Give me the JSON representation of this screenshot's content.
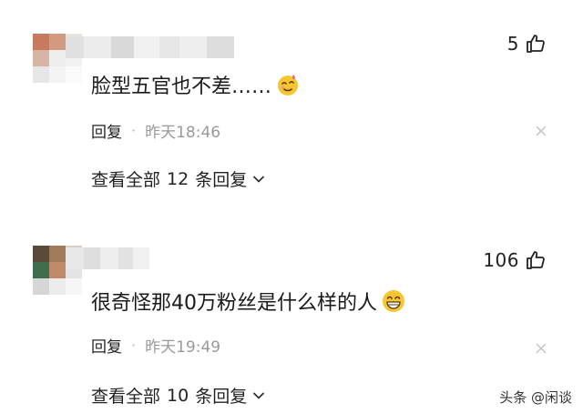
{
  "comments": [
    {
      "avatar_colors": [
        "#c77a5e",
        "#d49a80",
        "#e8e4e0",
        "#d8b4a4",
        "#eeeeee",
        "#f2f2f2",
        "#e6e6e6",
        "#f4f4f4",
        "#fafafa"
      ],
      "name_blur_colors": [
        "#e0e0e0",
        "#ececec",
        "#d9d9d9",
        "#f0f0f0",
        "#e6e6e6",
        "#eeeeee",
        "#dddddd"
      ],
      "likes": "5",
      "text": "脸型五官也不差……",
      "emoji": "smiling-face-with-tear-emoji",
      "reply_label": "回复",
      "separator": "·",
      "time": "昨天18:46",
      "view_all_prefix": "查看全部",
      "reply_count": "12",
      "view_all_suffix": "条回复"
    },
    {
      "avatar_colors": [
        "#5a4a3a",
        "#a07a5a",
        "#d8cfc6",
        "#3f6e4e",
        "#c08a6a",
        "#e4e4e4",
        "#d6d6d6",
        "#ececec",
        "#f6f6f6"
      ],
      "name_blur_colors": [
        "#e8e8e8",
        "#dedede",
        "#eeeeee",
        "#e2e2e2",
        "#f0f0f0"
      ],
      "likes": "106",
      "text": "很奇怪那40万粉丝是什么样的人",
      "emoji": "grinning-face-emoji",
      "reply_label": "回复",
      "separator": "·",
      "time": "昨天19:49",
      "view_all_prefix": "查看全部",
      "reply_count": "10",
      "view_all_suffix": "条回复"
    }
  ],
  "watermark": "头条 @闲谈",
  "colors": {
    "text": "#1a1a1a",
    "muted": "#9a9a9a",
    "emoji_yellow": "#f7c530"
  }
}
